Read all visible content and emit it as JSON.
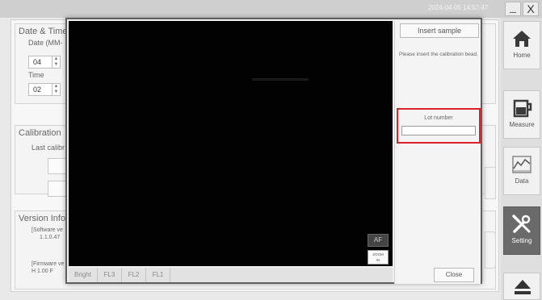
{
  "topbar": {
    "datetime": "2024-04-05 14:57:47",
    "minimize_label": "_",
    "close_label": "X"
  },
  "settings": {
    "datetime_group": {
      "title": "Date & Time",
      "date_label": "Date (MM-",
      "month_value": "04",
      "time_label": "Time",
      "hour_value": "02"
    },
    "calibration_group": {
      "title": "Calibration",
      "last_label": "Last calibr"
    },
    "version_group": {
      "title": "Version Info",
      "software_label": "[Software ve",
      "software_value": "1.1.0.47",
      "firmware_label": "[Firmware ve",
      "firmware_value": "H 1.00  F"
    }
  },
  "sidebar": {
    "items": [
      {
        "label": "Home",
        "icon": "home-icon"
      },
      {
        "label": "Measure",
        "icon": "beaker-icon"
      },
      {
        "label": "Data",
        "icon": "chart-icon"
      },
      {
        "label": "Setting",
        "icon": "tools-icon"
      }
    ],
    "active": "Setting",
    "eject_icon": "eject-icon"
  },
  "modal": {
    "viewer": {
      "af_label": "AF",
      "zoom_label_1": "ZOOM",
      "zoom_label_2": "IN"
    },
    "filter_tabs": [
      "Bright",
      "FL3",
      "FL2",
      "FL1"
    ],
    "insert_button": "Insert sample",
    "instruction": "Please insert the calibration bead.",
    "lot": {
      "label": "Lot number",
      "value": "",
      "placeholder": ""
    },
    "close_button": "Close"
  },
  "colors": {
    "highlight": "#d8232a",
    "active_nav": "#6a6a6a",
    "viewer_bg": "#020202"
  }
}
